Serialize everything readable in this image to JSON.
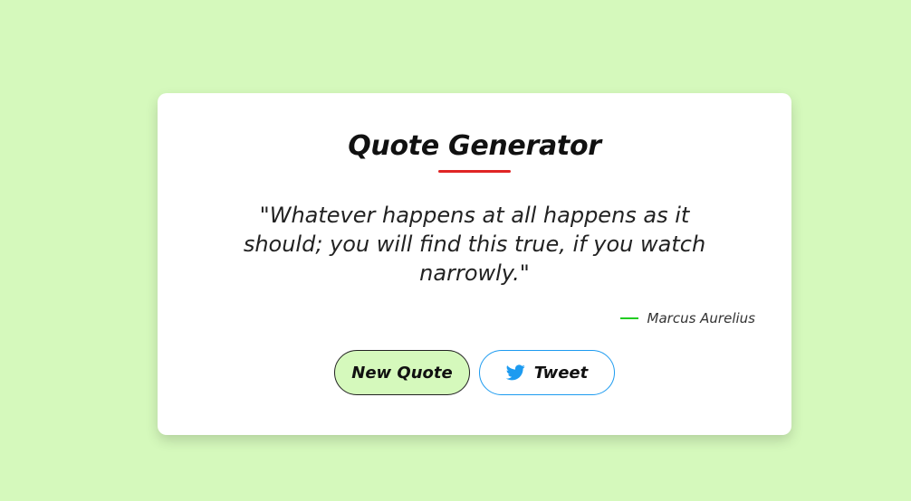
{
  "colors": {
    "page_background": "#d5f9bc",
    "card_background": "#ffffff",
    "underline": "#e02424",
    "author_dash": "#22cc22",
    "tweet_border": "#1d9bf0",
    "twitter_icon": "#1d9bf0",
    "new_quote_bg": "#d5f9bc"
  },
  "card": {
    "title": "Quote Generator",
    "quote": "\"Whatever happens at all happens as it should; you will find this true, if you watch narrowly.\"",
    "author": "Marcus Aurelius"
  },
  "buttons": {
    "new_quote_label": "New Quote",
    "tweet_label": "Tweet",
    "tweet_icon": "twitter-bird-icon"
  }
}
